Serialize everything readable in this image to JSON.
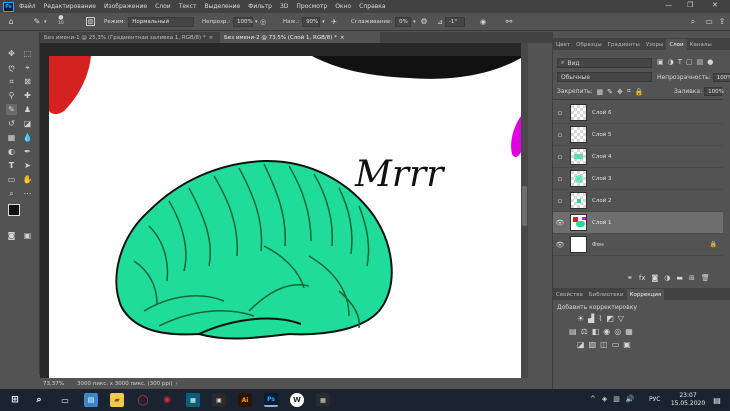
{
  "menu": {
    "logo": "Ps",
    "items": [
      "Файл",
      "Редактирование",
      "Изображение",
      "Слои",
      "Текст",
      "Выделение",
      "Фильтр",
      "3D",
      "Просмотр",
      "Окно",
      "Справка"
    ]
  },
  "options": {
    "brush_size": "10",
    "mode_label": "Режим:",
    "mode_value": "Нормальный",
    "opacity_label": "Непрозр.:",
    "opacity_value": "100%",
    "pressure_label": "Наж.:",
    "pressure_value": "90%",
    "smoothing_label": "Сглаживание:",
    "smoothing_value": "0%",
    "angle_value": "-1°"
  },
  "tabs": [
    {
      "label": "Без имени-1 @ 25,3% (Градиентная заливка 1, RGB/8) *",
      "close": "×"
    },
    {
      "label": "Без имени-2 @ 73,5% (Слой 1, RGB/8) *",
      "close": "×"
    }
  ],
  "canvas_text": "Mrrr",
  "status": {
    "zoom": "73,37%",
    "doc_info": "3000 пикс. x 3000 пикс. (300 ppi)"
  },
  "panel_tabs_top": [
    "Цвет",
    "Образцы",
    "Градиенты",
    "Узоры",
    "Слои",
    "Каналы"
  ],
  "layers_panel": {
    "search_value": "Вид",
    "blend_mode": "Обычные",
    "opacity_label": "Непрозрачность:",
    "opacity_value": "100%",
    "lock_label": "Закрепить:",
    "fill_label": "Заливка:",
    "fill_value": "100%",
    "layers": [
      {
        "name": "Слой 6",
        "visible": false,
        "selected": false,
        "thumb": "checker"
      },
      {
        "name": "Слой 5",
        "visible": false,
        "selected": false,
        "thumb": "checker"
      },
      {
        "name": "Слой 4",
        "visible": false,
        "selected": false,
        "thumb": "checker-dots"
      },
      {
        "name": "Слой 3",
        "visible": false,
        "selected": false,
        "thumb": "checker-dots"
      },
      {
        "name": "Слой 2",
        "visible": false,
        "selected": false,
        "thumb": "checker-dot"
      },
      {
        "name": "Слой 1",
        "visible": true,
        "selected": true,
        "thumb": "drawing"
      },
      {
        "name": "Фон",
        "visible": true,
        "selected": false,
        "thumb": "white",
        "locked": true
      }
    ]
  },
  "panel_tabs_bottom": [
    "Свойства",
    "Библиотеки",
    "Коррекция"
  ],
  "adjustments": {
    "title": "Добавить корректировку"
  },
  "taskbar": {
    "lang": "РУС",
    "time": "23:07",
    "date": "15.05.2020"
  },
  "colors": {
    "cat_fill": "#1fdc9a",
    "ps_blue": "#31a8ff",
    "magenta": "#e000e0",
    "red": "#d62121"
  }
}
